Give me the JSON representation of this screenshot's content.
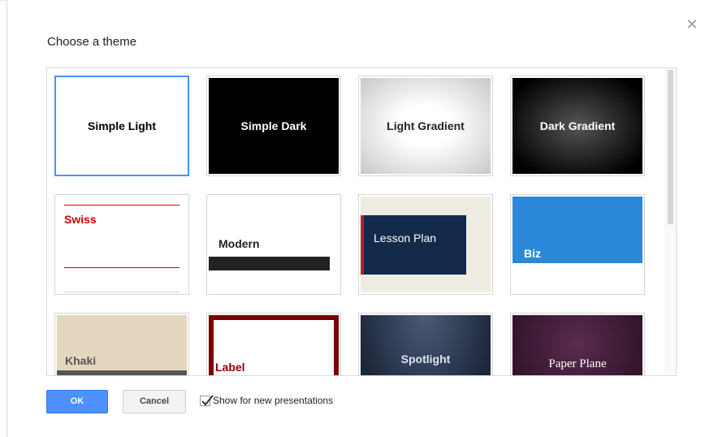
{
  "dialog": {
    "title": "Choose a theme",
    "close_icon": "close-icon"
  },
  "themes": [
    {
      "name": "Simple Light",
      "selected": true
    },
    {
      "name": "Simple Dark",
      "selected": false
    },
    {
      "name": "Light Gradient",
      "selected": false
    },
    {
      "name": "Dark Gradient",
      "selected": false
    },
    {
      "name": "Swiss",
      "selected": false
    },
    {
      "name": "Modern",
      "selected": false
    },
    {
      "name": "Lesson Plan",
      "selected": false
    },
    {
      "name": "Biz",
      "selected": false
    },
    {
      "name": "Khaki",
      "selected": false
    },
    {
      "name": "Label",
      "selected": false
    },
    {
      "name": "Spotlight",
      "selected": false
    },
    {
      "name": "Paper Plane",
      "selected": false
    }
  ],
  "footer": {
    "ok_label": "OK",
    "cancel_label": "Cancel",
    "show_for_new_label": "Show for new presentations",
    "show_for_new_checked": true
  },
  "colors": {
    "accent": "#4d90fe",
    "swiss_red": "#cc0000",
    "biz_blue": "#2b87d9",
    "label_maroon": "#7a0000"
  }
}
